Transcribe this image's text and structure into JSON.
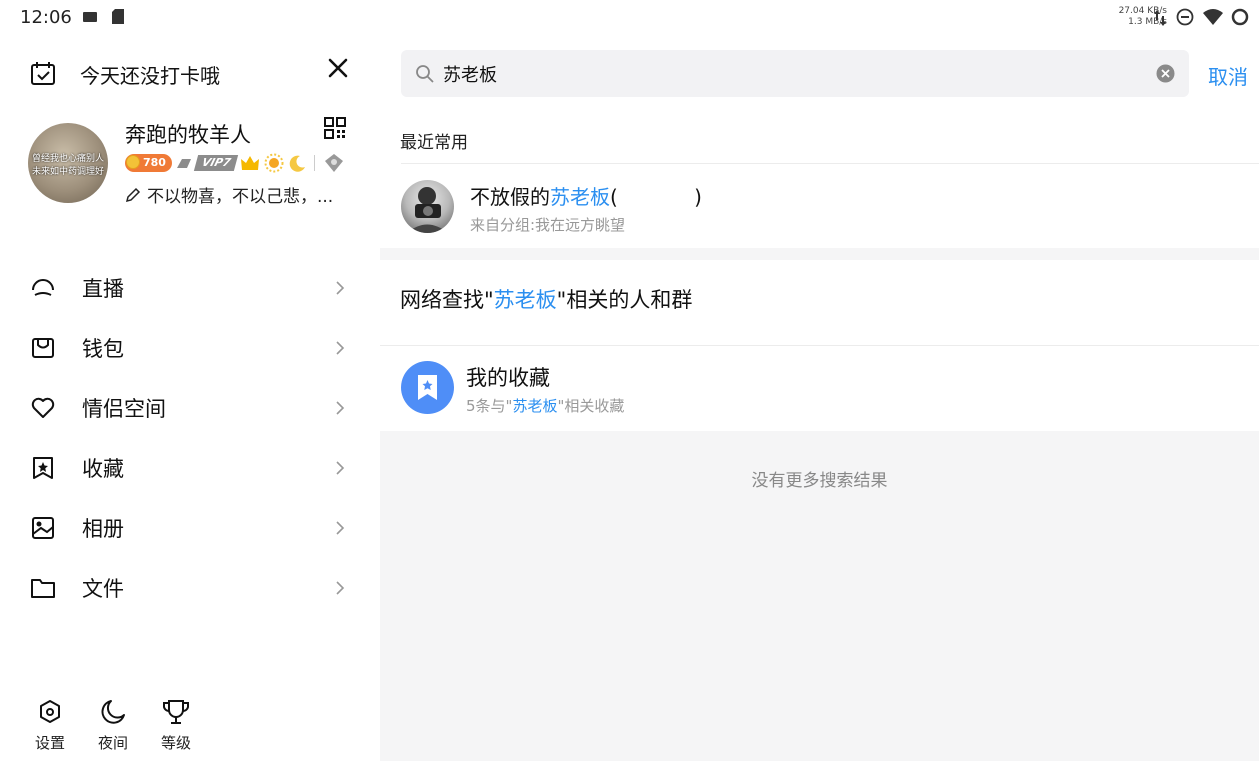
{
  "status_bar": {
    "time": "12:06",
    "net_up": "27.04 KB/s",
    "net_down": "1.3 MB/s"
  },
  "drawer": {
    "checkin_text": "今天还没打卡哦",
    "nickname": "奔跑的牧羊人",
    "avatar_text": "曾经我也心痛别人 未来如中药调理好",
    "level_badge": "780",
    "vip_badge": "VIP7",
    "signature": "不以物喜，不以己悲，...",
    "menu": [
      {
        "label": "直播",
        "icon": "live-icon"
      },
      {
        "label": "钱包",
        "icon": "wallet-icon"
      },
      {
        "label": "情侣空间",
        "icon": "heart-icon"
      },
      {
        "label": "收藏",
        "icon": "favorite-icon"
      },
      {
        "label": "相册",
        "icon": "album-icon"
      },
      {
        "label": "文件",
        "icon": "folder-icon"
      }
    ],
    "tools": [
      {
        "label": "设置",
        "icon": "settings-icon"
      },
      {
        "label": "夜间",
        "icon": "moon-icon"
      },
      {
        "label": "等级",
        "icon": "trophy-icon"
      }
    ]
  },
  "search": {
    "query": "苏老板",
    "cancel": "取消",
    "recent_title": "最近常用",
    "contact": {
      "name_prefix": "不放假的",
      "name_highlight": "苏老板",
      "name_suffix": "(            )",
      "group": "来自分组:我在远方眺望"
    },
    "web_search": {
      "prefix": "网络查找\"",
      "highlight": "苏老板",
      "suffix": "\"相关的人和群"
    },
    "favorites": {
      "title": "我的收藏",
      "sub_prefix": "5条与\"",
      "sub_highlight": "苏老板",
      "sub_suffix": "\"相关收藏"
    },
    "no_more": "没有更多搜索结果"
  },
  "colors": {
    "accent": "#2b8ff0",
    "fav_icon_bg": "#4f8ef7"
  }
}
